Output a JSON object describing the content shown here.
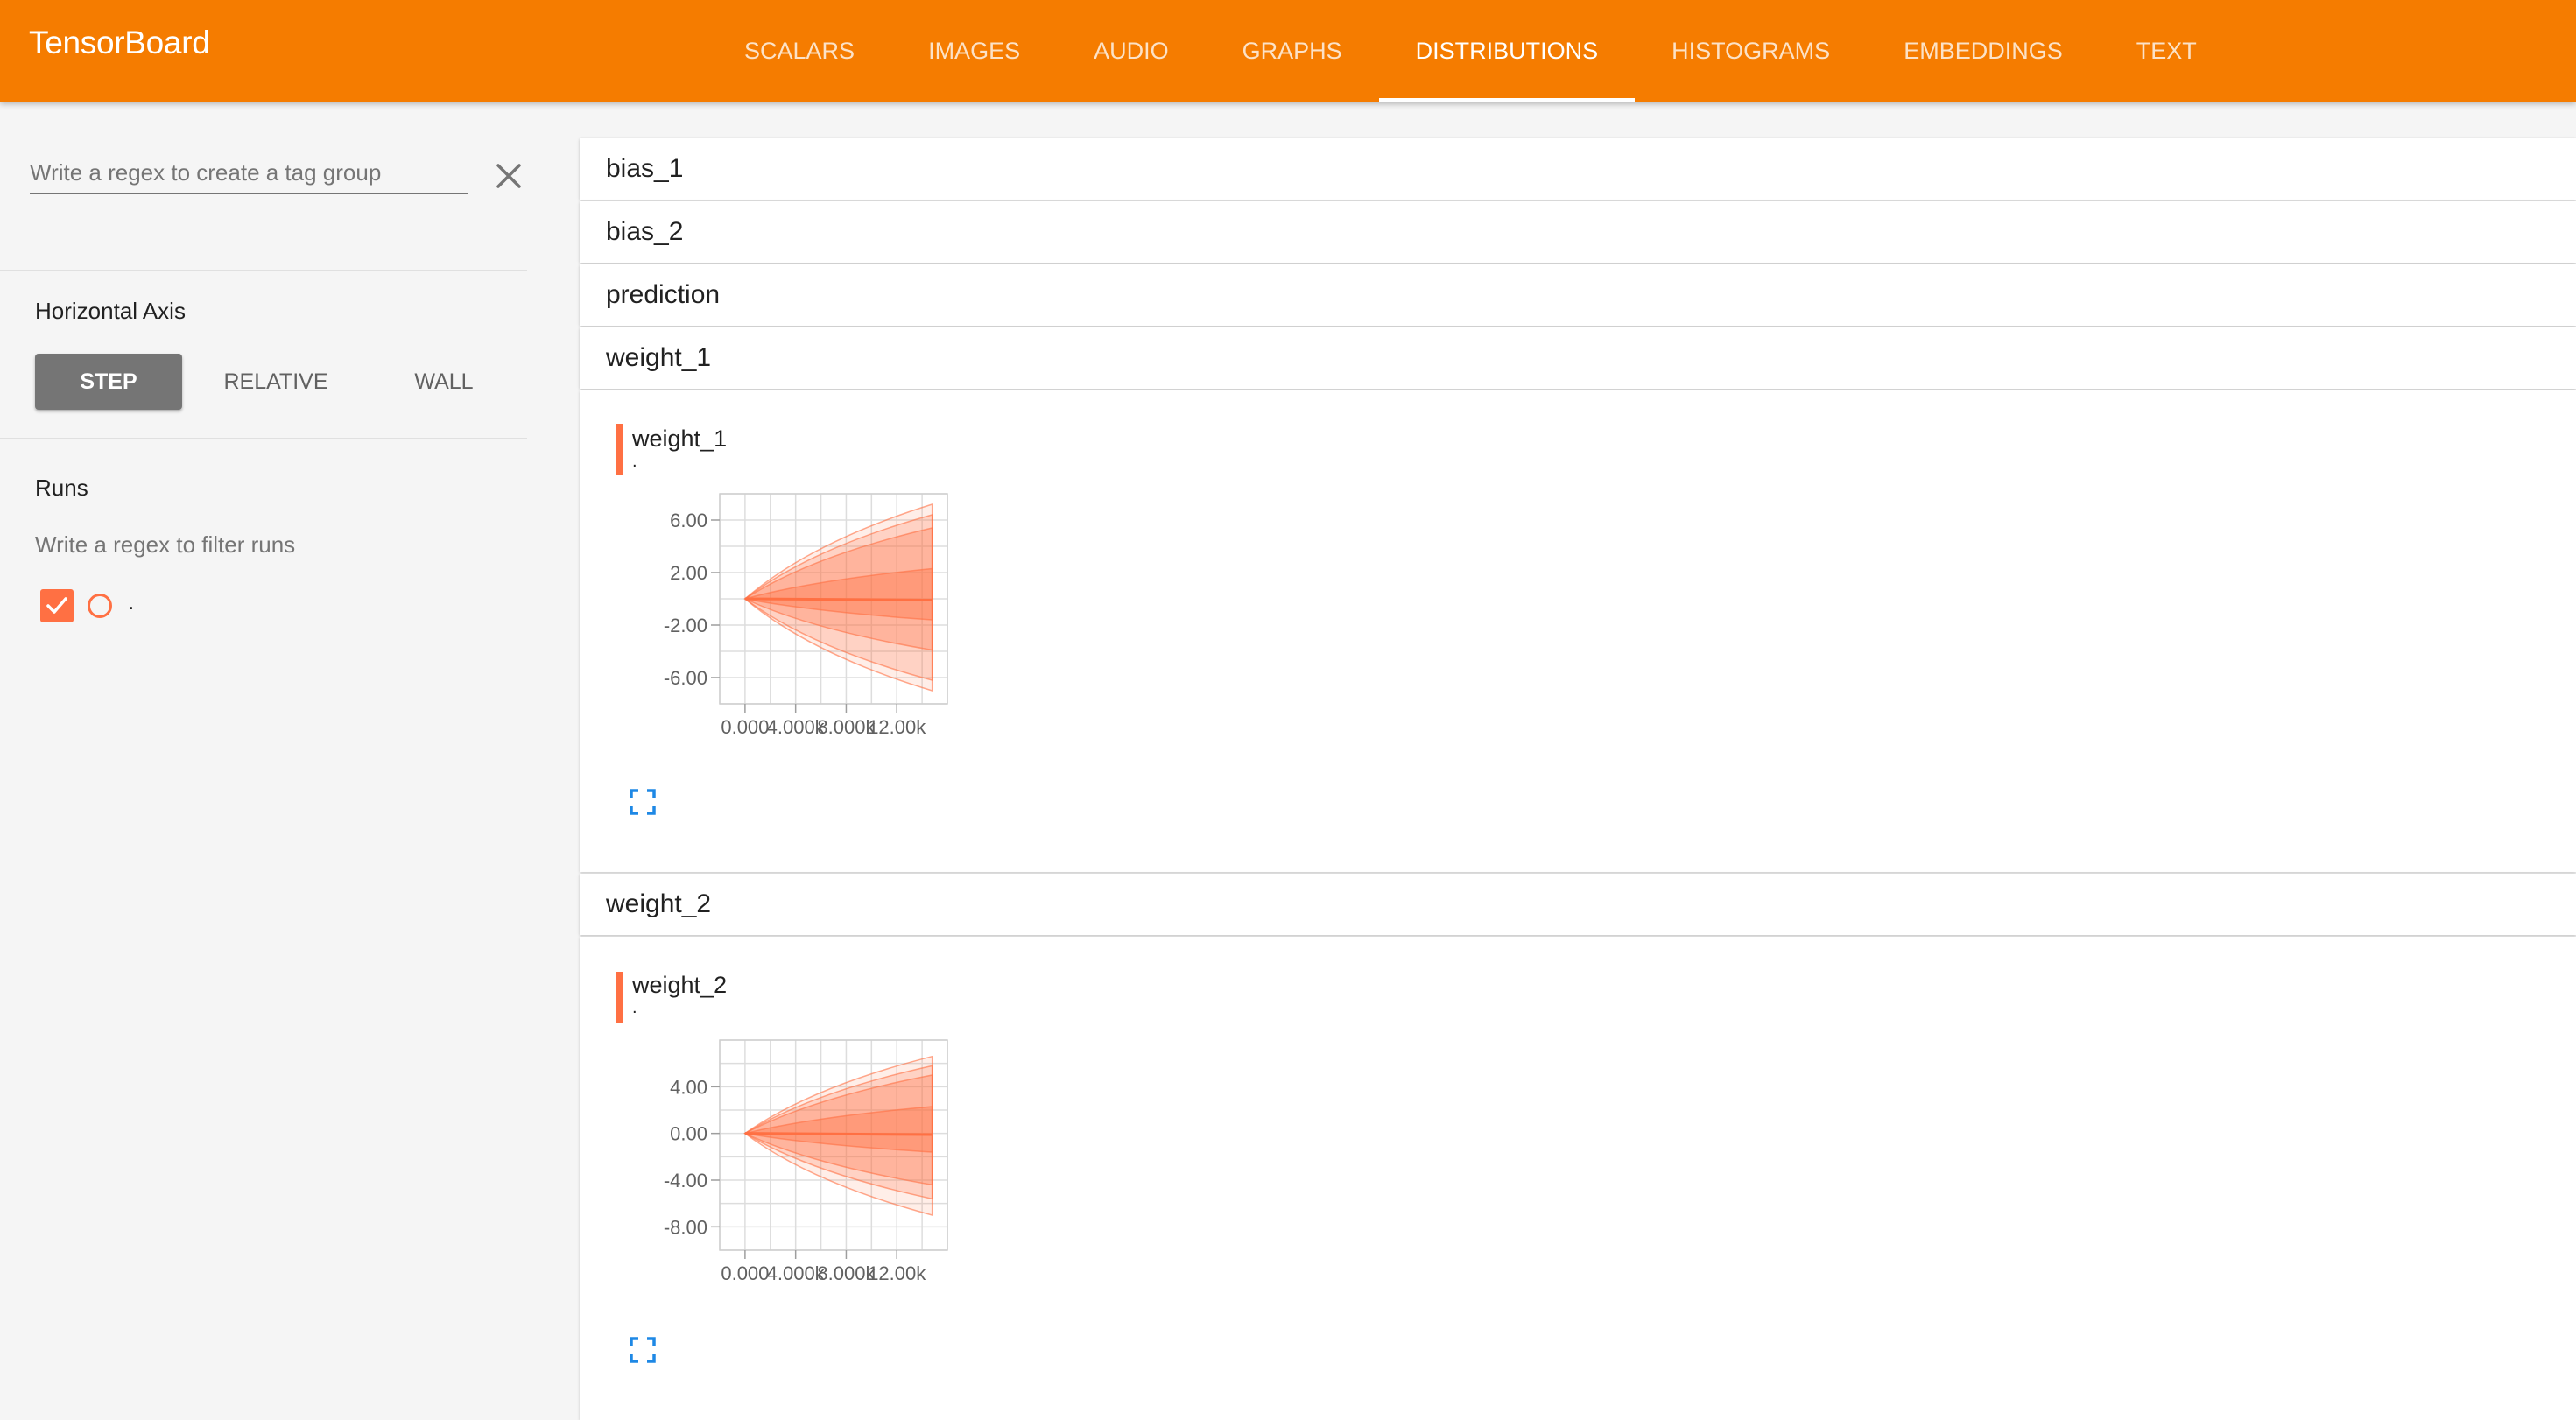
{
  "app": {
    "title": "TensorBoard",
    "tabs": [
      "SCALARS",
      "IMAGES",
      "AUDIO",
      "GRAPHS",
      "DISTRIBUTIONS",
      "HISTOGRAMS",
      "EMBEDDINGS",
      "TEXT"
    ],
    "active_tab": "DISTRIBUTIONS",
    "accent_color": "#f57c00",
    "series_color": "#ff7043"
  },
  "sidebar": {
    "tag_group_placeholder": "Write a regex to create a tag group",
    "clear_icon": "close-icon",
    "horizontal_axis_label": "Horizontal Axis",
    "axis_options": [
      "STEP",
      "RELATIVE",
      "WALL"
    ],
    "axis_selected": "STEP",
    "runs_label": "Runs",
    "runs_filter_placeholder": "Write a regex to filter runs",
    "runs": [
      {
        "name": ".",
        "checked": true,
        "icon": "circle-outline-icon"
      }
    ]
  },
  "panes": [
    {
      "label": "bias_1",
      "expanded": false
    },
    {
      "label": "bias_2",
      "expanded": false
    },
    {
      "label": "prediction",
      "expanded": false
    },
    {
      "label": "weight_1",
      "expanded": true
    },
    {
      "label": "weight_2",
      "expanded": true
    }
  ],
  "cards": [
    {
      "title": "weight_1",
      "run": ".",
      "expand_icon": "fullscreen-icon"
    },
    {
      "title": "weight_2",
      "run": ".",
      "expand_icon": "fullscreen-icon"
    }
  ],
  "chart_data": [
    {
      "type": "area",
      "title": "weight_1",
      "x_ticks": [
        "0.000",
        "4.000k",
        "8.000k",
        "12.00k"
      ],
      "y_ticks": [
        "6.00",
        "2.00",
        "-2.00",
        "-6.00"
      ],
      "xlim": [
        -2000,
        16000
      ],
      "ylim": [
        -8,
        8
      ],
      "x": [
        0,
        14800
      ],
      "bands": [
        {
          "lower": [
            0,
            -7.0
          ],
          "upper": [
            0,
            7.2
          ]
        },
        {
          "lower": [
            0,
            -6.2
          ],
          "upper": [
            0,
            6.4
          ]
        },
        {
          "lower": [
            0,
            -3.9
          ],
          "upper": [
            0,
            5.4
          ]
        },
        {
          "lower": [
            0,
            -1.6
          ],
          "upper": [
            0,
            2.3
          ]
        }
      ],
      "median": [
        0,
        -0.1
      ]
    },
    {
      "type": "area",
      "title": "weight_2",
      "x_ticks": [
        "0.000",
        "4.000k",
        "8.000k",
        "12.00k"
      ],
      "y_ticks": [
        "4.00",
        "0.00",
        "-4.00",
        "-8.00"
      ],
      "xlim": [
        -2000,
        16000
      ],
      "ylim": [
        -10,
        8
      ],
      "x": [
        0,
        14800
      ],
      "bands": [
        {
          "lower": [
            0,
            -7.0
          ],
          "upper": [
            0,
            6.6
          ]
        },
        {
          "lower": [
            0,
            -5.6
          ],
          "upper": [
            0,
            5.8
          ]
        },
        {
          "lower": [
            0,
            -4.4
          ],
          "upper": [
            0,
            5.0
          ]
        },
        {
          "lower": [
            0,
            -1.6
          ],
          "upper": [
            0,
            2.3
          ]
        }
      ],
      "median": [
        0,
        -0.1
      ]
    }
  ]
}
